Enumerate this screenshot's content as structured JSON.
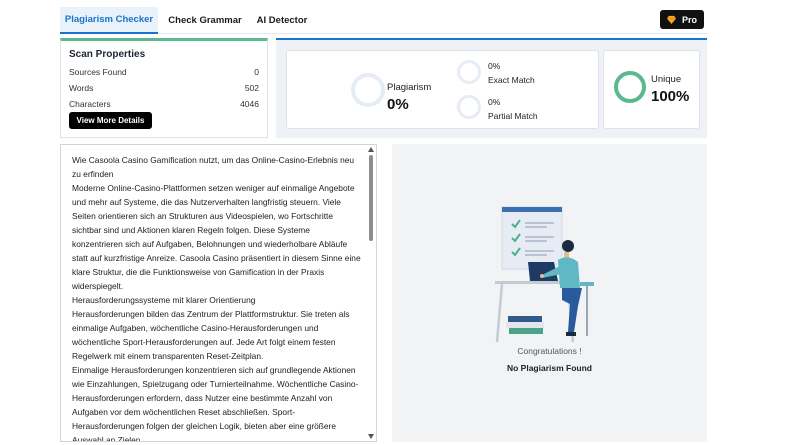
{
  "tabs": [
    {
      "label": "Plagiarism Checker",
      "active": true
    },
    {
      "label": "Check Grammar",
      "active": false
    },
    {
      "label": "AI Detector",
      "active": false
    }
  ],
  "pro_button": {
    "label": "Pro",
    "icon": "diamond-icon",
    "icon_color": "#f5a623"
  },
  "scan_properties": {
    "title": "Scan Properties",
    "rows": [
      {
        "label": "Sources Found",
        "value": "0"
      },
      {
        "label": "Words",
        "value": "502"
      },
      {
        "label": "Characters",
        "value": "4046"
      }
    ],
    "button_label": "View More Details"
  },
  "results": {
    "plagiarism": {
      "label": "Plagiarism",
      "value": "0%"
    },
    "exact_match": {
      "label": "Exact Match",
      "value": "0%"
    },
    "partial_match": {
      "label": "Partial Match",
      "value": "0%"
    },
    "unique": {
      "label": "Unique",
      "value": "100%"
    }
  },
  "colors": {
    "accent": "#1a73c8",
    "success": "#5cb88f"
  },
  "text_content": [
    "Wie Casoola Casino Gamification nutzt, um das Online-Casino-Erlebnis neu zu erfinden",
    "Moderne Online-Casino-Plattformen setzen weniger auf einmalige Angebote und mehr auf Systeme, die das Nutzerverhalten langfristig steuern. Viele Seiten orientieren sich an Strukturen aus Videospielen, wo Fortschritte sichtbar sind und Aktionen klaren Regeln folgen. Diese Systeme konzentrieren sich auf Aufgaben, Belohnungen und wiederholbare Abläufe statt auf kurzfristige Anreize. Casoola Casino präsentiert in diesem Sinne eine klare Struktur, die die Funktionsweise von Gamification in der Praxis widerspiegelt.",
    "Herausforderungssysteme mit klarer Orientierung",
    "Herausforderungen bilden das Zentrum der Plattformstruktur. Sie treten als einmalige Aufgaben, wöchentliche Casino-Herausforderungen und wöchentliche Sport-Herausforderungen auf. Jede Art folgt einem festen Regelwerk mit einem transparenten Reset-Zeitplan.",
    "Einmalige Herausforderungen konzentrieren sich auf grundlegende Aktionen wie Einzahlungen, Spielzugang oder Turnierteilnahme. Wöchentliche Casino-Herausforderungen erfordern, dass Nutzer eine bestimmte Anzahl von Aufgaben vor dem wöchentlichen Reset abschließen. Sport-Herausforderungen folgen der gleichen Logik, bieten aber eine größere Auswahl an Zielen."
  ],
  "result_message": {
    "congrats": "Congratulations !",
    "status": "No Plagiarism Found"
  }
}
